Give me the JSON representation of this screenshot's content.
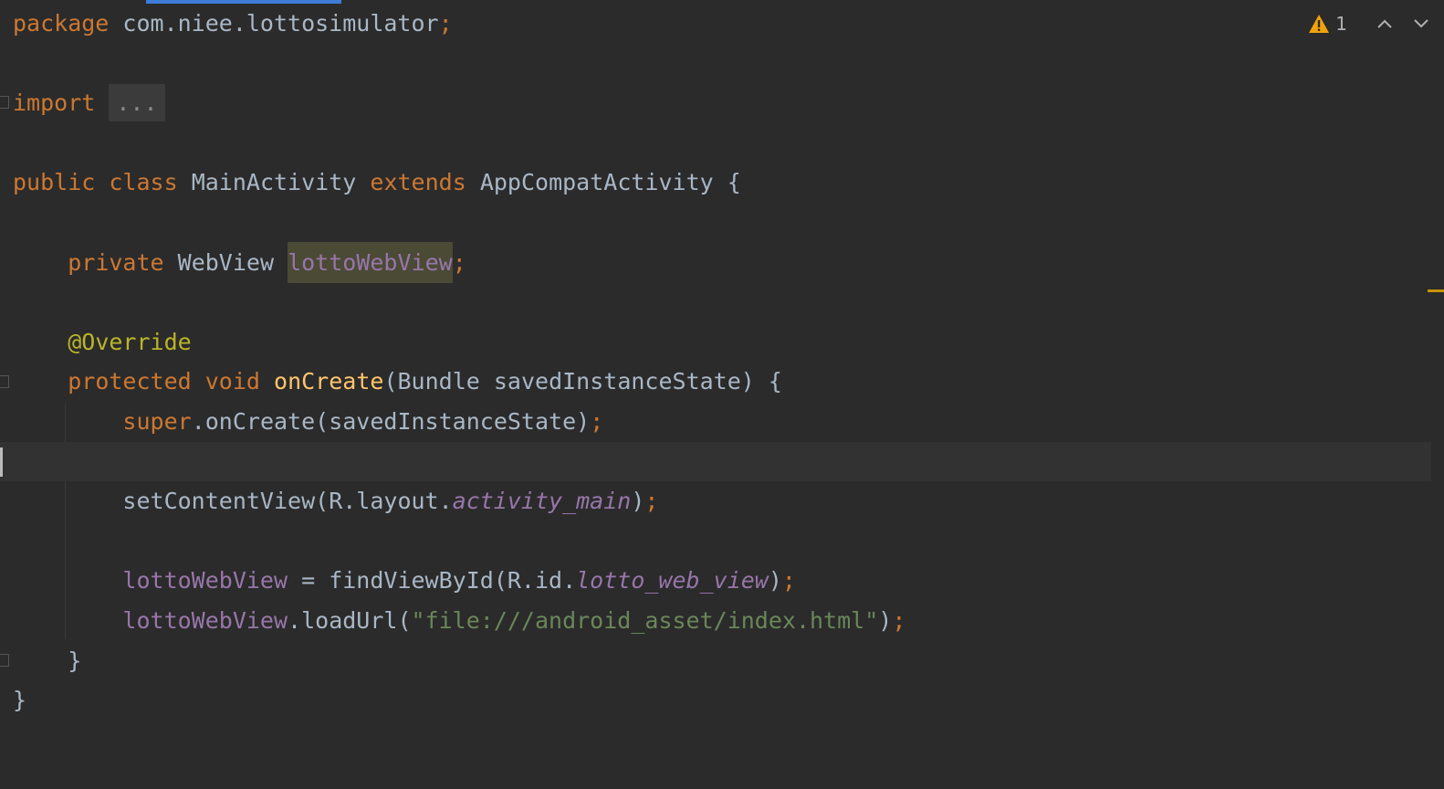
{
  "editor": {
    "code": {
      "package_kw": "package",
      "package_name": " com.niee.lottosimulator",
      "semicolon": ";",
      "import_kw": "import",
      "import_fold": "...",
      "public_kw": "public",
      "class_kw": "class",
      "class_name": "MainActivity",
      "extends_kw": "extends",
      "parent_class": "AppCompatActivity",
      "open_brace": "{",
      "close_brace": "}",
      "private_kw": "private",
      "webview_type": "WebView",
      "field_name": "lottoWebView",
      "annotation": "@Override",
      "protected_kw": "protected",
      "void_kw": "void",
      "method_name": "onCreate",
      "params": "(Bundle savedInstanceState) {",
      "super_kw": "super",
      "super_call": ".onCreate(savedInstanceState)",
      "set_content": "setContentView(R.layout.",
      "layout_res": "activity_main",
      "close_paren": ")",
      "assign": " = findViewById(R.id.",
      "view_id": "lotto_web_view",
      "load_url": ".loadUrl(",
      "url_string": "\"file:///android_asset/index.html\""
    },
    "inspections": {
      "warning_count": "1",
      "warning_icon": "warning-triangle-icon",
      "prev_icon": "chevron-up-icon",
      "next_icon": "chevron-down-icon"
    },
    "colors": {
      "background": "#2b2b2b",
      "keyword": "#cc7832",
      "annotation": "#bbb529",
      "method": "#ffc66d",
      "field": "#9876aa",
      "string": "#6a8759",
      "text": "#a9b7c6",
      "warning": "#f0a30a"
    }
  }
}
